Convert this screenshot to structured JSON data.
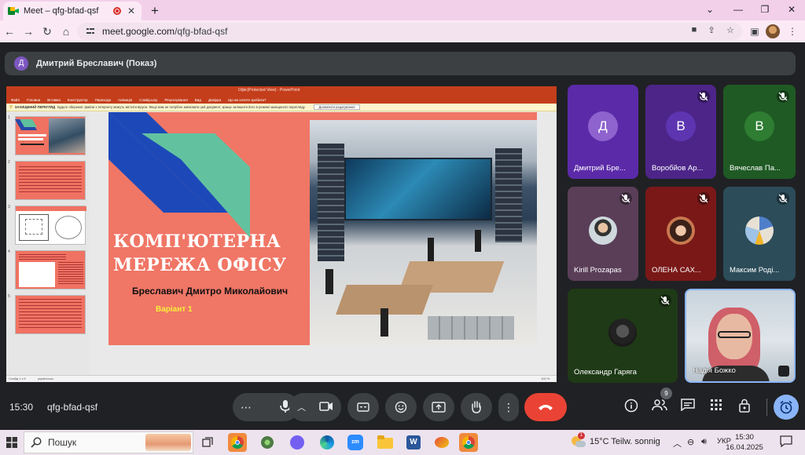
{
  "browser": {
    "tab_title": "Meet – qfg-bfad-qsf",
    "url_host": "meet.google.com",
    "url_path": "/qfg-bfad-qsf"
  },
  "meet": {
    "presenter_initial": "Д",
    "presenter_label": "Дмитрий Бреславич (Показ)",
    "time": "15:30",
    "meeting_code": "qfg-bfad-qsf",
    "participant_count": "9"
  },
  "presentation": {
    "window_title": "Офіс(Protected View) - PowerPoint",
    "menu": [
      "Файл",
      "Головна",
      "Вставка",
      "Конструктор",
      "Переходи",
      "Анімація",
      "Слайд-шоу",
      "Рецензування",
      "Вид",
      "Довідка",
      "Що ви хочете зробити?"
    ],
    "protected_view_label": "ЗАХИЩЕНИЙ ПЕРЕГЛЯД",
    "protected_view_text": "Будьте обережні: файли з Інтернету можуть містити віруси. Якщо вам не потрібно змінювати цей документ, краще залишити його в режимі захищеного перегляду.",
    "enable_editing": "Дозволити редагування",
    "slide_title_line1": "КОМП'ЮТЕРНА",
    "slide_title_line2": "МЕРЕЖА ОФІСУ",
    "slide_author": "Бреславич Дмитро Миколайович",
    "slide_variant": "Варіант 1",
    "thumb_numbers": [
      "1",
      "2",
      "3",
      "4",
      "5"
    ],
    "status_slide": "Слайд 1 з 5",
    "status_lang": "українська",
    "status_zoom": "100 %"
  },
  "participants": [
    {
      "name": "Дмитрий Бре...",
      "initial": "Д",
      "color": "#5b2aa8",
      "avatar_color": "#8e63ce",
      "muted": false
    },
    {
      "name": "Воробйов Ар...",
      "initial": "В",
      "color": "#4d2589",
      "avatar_color": "#5e35b1",
      "muted": true
    },
    {
      "name": "Вячеслав Па...",
      "initial": "В",
      "color": "#1f5a24",
      "avatar_color": "#2e7d32",
      "muted": true
    },
    {
      "name": "Kirill Prozapas",
      "photo": "person",
      "color": "#5a3e58",
      "muted": true
    },
    {
      "name": "ОЛЕНА САХ...",
      "photo": "woman",
      "color": "#7a1818",
      "muted": true
    },
    {
      "name": "Максим Роді...",
      "photo": "map",
      "color": "#2c4c5a",
      "muted": true
    },
    {
      "name": "Олександр Гаряга",
      "photo": "dark",
      "color": "#1f3a16",
      "muted": true
    },
    {
      "name": "Надія Божко",
      "photo": "camera",
      "color": "#c9d4dd",
      "muted": false
    }
  ],
  "taskbar": {
    "search_label": "Пошук",
    "weather": "15°C  Teilw. sonnig",
    "weather_badge": "1",
    "language": "УКР",
    "clock_time": "15:30",
    "clock_date": "16.04.2025"
  },
  "colors": {
    "meet_bg": "#202124",
    "end_call": "#ea4335",
    "ppt_red": "#c43e1c",
    "slide_bg": "#f07666"
  }
}
